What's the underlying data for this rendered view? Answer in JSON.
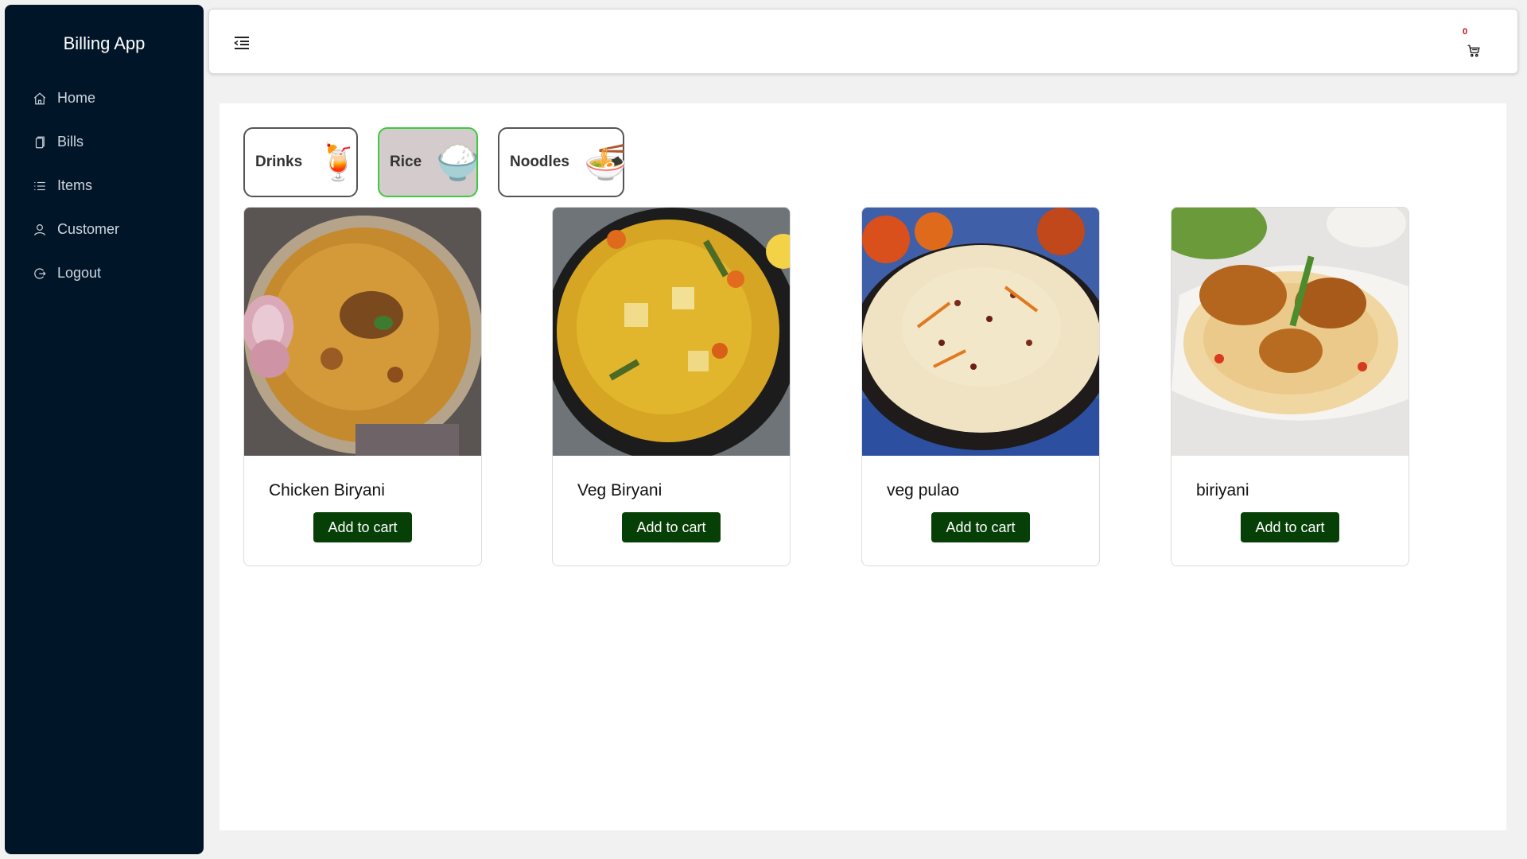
{
  "app": {
    "title": "Billing App"
  },
  "sidebar": {
    "items": [
      {
        "label": "Home",
        "icon": "home-icon"
      },
      {
        "label": "Bills",
        "icon": "bills-icon"
      },
      {
        "label": "Items",
        "icon": "list-icon"
      },
      {
        "label": "Customer",
        "icon": "user-icon"
      },
      {
        "label": "Logout",
        "icon": "logout-icon"
      }
    ]
  },
  "header": {
    "menu_icon": "menu-fold-icon",
    "cart_count": "0",
    "cart_icon": "cart-icon"
  },
  "categories": [
    {
      "label": "Drinks",
      "emoji": "🍹",
      "active": false
    },
    {
      "label": "Rice",
      "emoji": "🍚",
      "active": true
    },
    {
      "label": "Noodles",
      "emoji": "🍜",
      "active": false
    }
  ],
  "products": [
    {
      "name": "Chicken Biryani",
      "button": "Add to cart"
    },
    {
      "name": "Veg Biryani",
      "button": "Add to cart"
    },
    {
      "name": "veg pulao",
      "button": "Add to cart"
    },
    {
      "name": "biriyani",
      "button": "Add to cart"
    }
  ],
  "colors": {
    "sidebar_bg": "#011528",
    "button_bg": "#064006",
    "active_category_border": "#3ec93e",
    "active_category_bg": "#d4cccc",
    "cart_count": "#c0101a"
  }
}
